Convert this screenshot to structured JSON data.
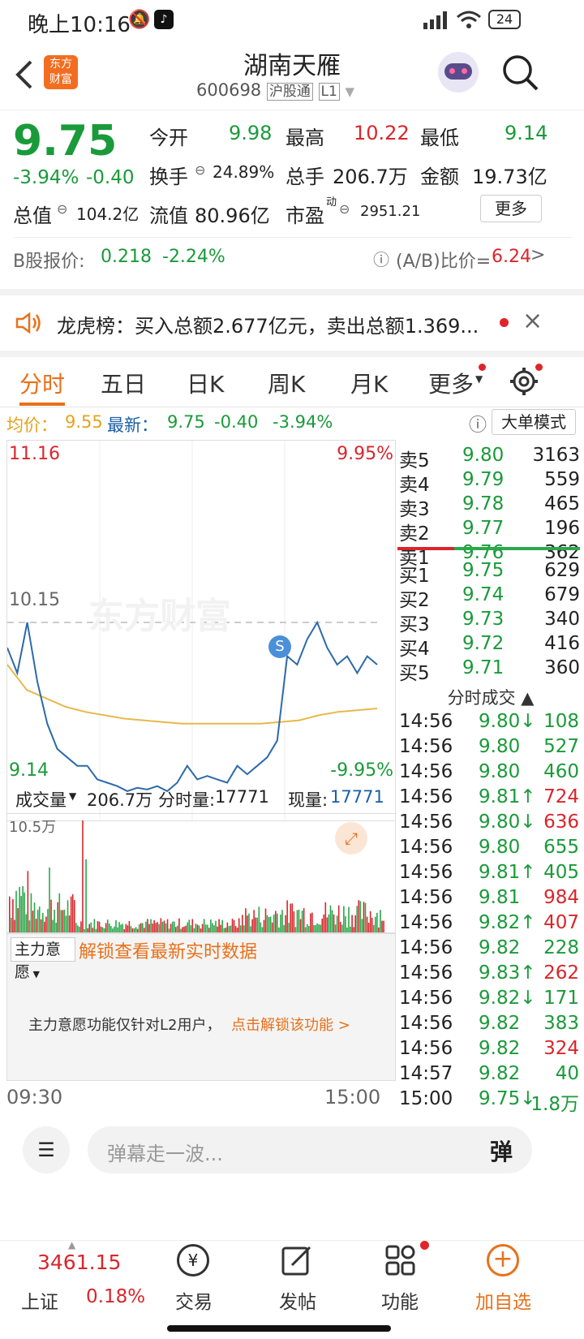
{
  "status": {
    "time": "晚上10:16",
    "battery": "24"
  },
  "header": {
    "logo_line1": "东方",
    "logo_line2": "财富",
    "name": "湖南天雁",
    "code": "600698",
    "tag1": "沪股通",
    "tag2": "L1"
  },
  "quote": {
    "price": "9.75",
    "pct": "-3.94%",
    "chg": "-0.40",
    "open_label": "今开",
    "open": "9.98",
    "high_label": "最高",
    "high": "10.22",
    "low_label": "最低",
    "low": "9.14",
    "turn_label": "换手",
    "turn": "24.89%",
    "vol_label": "总手",
    "vol": "206.7万",
    "amt_label": "金额",
    "amt": "19.73亿",
    "mcap_label": "总值",
    "mcap": "104.2亿",
    "float_label": "流值",
    "float": "80.96亿",
    "pe_label": "市盈",
    "pe_sup": "动",
    "pe": "2951.21",
    "more": "更多",
    "b_label": "B股报价:",
    "b_price": "0.218",
    "b_pct": "-2.24%",
    "ab_label": "(A/B)比价=",
    "ab_val": "6.24"
  },
  "lhb": {
    "text": "龙虎榜：买入总额2.677亿元，卖出总额1.369..."
  },
  "tabs": [
    "分时",
    "五日",
    "日K",
    "周K",
    "月K",
    "更多"
  ],
  "avgline": {
    "avg_label": "均价：",
    "avg": "9.55",
    "new_label": "最新：",
    "new": "9.75",
    "chg": "-0.40",
    "pct": "-3.94%",
    "mode": "大单模式"
  },
  "chart": {
    "top_price": "11.16",
    "top_pct": "9.95%",
    "mid_price": "10.15",
    "bot_price": "9.14",
    "bot_pct": "-9.95%",
    "watermark": "东方财富",
    "signal": "S",
    "vol_label": "成交量",
    "vol_total": "206.7万",
    "fs_label": "分时量:",
    "fs_val": "17771",
    "xl_label": "现量:",
    "xl_val": "17771",
    "vol_max": "10.5万",
    "zl_label": "主力意愿",
    "zl_lock": "解锁查看最新实时数据",
    "zl_msg": "主力意愿功能仅针对L2用户，",
    "zl_link": "点击解锁该功能 >",
    "t_start": "09:30",
    "t_end": "15:00",
    "price_series": [
      10.0,
      9.85,
      10.15,
      9.8,
      9.55,
      9.4,
      9.35,
      9.3,
      9.3,
      9.22,
      9.2,
      9.18,
      9.15,
      9.17,
      9.16,
      9.18,
      9.15,
      9.2,
      9.3,
      9.22,
      9.24,
      9.22,
      9.2,
      9.3,
      9.25,
      9.3,
      9.35,
      9.45,
      9.95,
      9.9,
      10.05,
      10.15,
      10.0,
      9.9,
      9.95,
      9.85,
      9.95,
      9.9
    ],
    "avg_series": [
      9.9,
      9.75,
      9.7,
      9.65,
      9.62,
      9.6,
      9.58,
      9.57,
      9.56,
      9.55,
      9.55,
      9.55,
      9.55,
      9.55,
      9.56,
      9.57,
      9.6,
      9.62,
      9.63,
      9.64
    ]
  },
  "orderbook": {
    "asks": [
      {
        "l": "卖5",
        "p": "9.80",
        "v": "3163"
      },
      {
        "l": "卖4",
        "p": "9.79",
        "v": "559"
      },
      {
        "l": "卖3",
        "p": "9.78",
        "v": "465"
      },
      {
        "l": "卖2",
        "p": "9.77",
        "v": "196"
      },
      {
        "l": "卖1",
        "p": "9.76",
        "v": "362"
      }
    ],
    "bids": [
      {
        "l": "买1",
        "p": "9.75",
        "v": "629"
      },
      {
        "l": "买2",
        "p": "9.74",
        "v": "679"
      },
      {
        "l": "买3",
        "p": "9.73",
        "v": "340"
      },
      {
        "l": "买4",
        "p": "9.72",
        "v": "416"
      },
      {
        "l": "买5",
        "p": "9.71",
        "v": "360"
      }
    ],
    "trades_title": "分时成交",
    "trades": [
      {
        "t": "14:56",
        "p": "9.80↓",
        "v": "108",
        "pc": "green",
        "vc": "green"
      },
      {
        "t": "14:56",
        "p": "9.80",
        "v": "527",
        "pc": "green",
        "vc": "green"
      },
      {
        "t": "14:56",
        "p": "9.80",
        "v": "460",
        "pc": "green",
        "vc": "green"
      },
      {
        "t": "14:56",
        "p": "9.81↑",
        "v": "724",
        "pc": "green",
        "vc": "red"
      },
      {
        "t": "14:56",
        "p": "9.80↓",
        "v": "636",
        "pc": "green",
        "vc": "red"
      },
      {
        "t": "14:56",
        "p": "9.80",
        "v": "655",
        "pc": "green",
        "vc": "green"
      },
      {
        "t": "14:56",
        "p": "9.81↑",
        "v": "405",
        "pc": "green",
        "vc": "green"
      },
      {
        "t": "14:56",
        "p": "9.81",
        "v": "984",
        "pc": "green",
        "vc": "red"
      },
      {
        "t": "14:56",
        "p": "9.82↑",
        "v": "407",
        "pc": "green",
        "vc": "red"
      },
      {
        "t": "14:56",
        "p": "9.82",
        "v": "228",
        "pc": "green",
        "vc": "green"
      },
      {
        "t": "14:56",
        "p": "9.83↑",
        "v": "262",
        "pc": "green",
        "vc": "red"
      },
      {
        "t": "14:56",
        "p": "9.82↓",
        "v": "171",
        "pc": "green",
        "vc": "green"
      },
      {
        "t": "14:56",
        "p": "9.82",
        "v": "383",
        "pc": "green",
        "vc": "green"
      },
      {
        "t": "14:56",
        "p": "9.82",
        "v": "324",
        "pc": "green",
        "vc": "red"
      },
      {
        "t": "14:57",
        "p": "9.82",
        "v": "40",
        "pc": "green",
        "vc": "green"
      },
      {
        "t": "15:00",
        "p": "9.75↓",
        "v": "1.8万",
        "pc": "green",
        "vc": "green"
      }
    ]
  },
  "comment": {
    "placeholder": "弹幕走一波...",
    "btn": "弹"
  },
  "nav": {
    "index_val": "3461.15",
    "index_name": "上证",
    "index_pct": "0.18%",
    "trade": "交易",
    "post": "发帖",
    "func": "功能",
    "add": "加自选"
  }
}
